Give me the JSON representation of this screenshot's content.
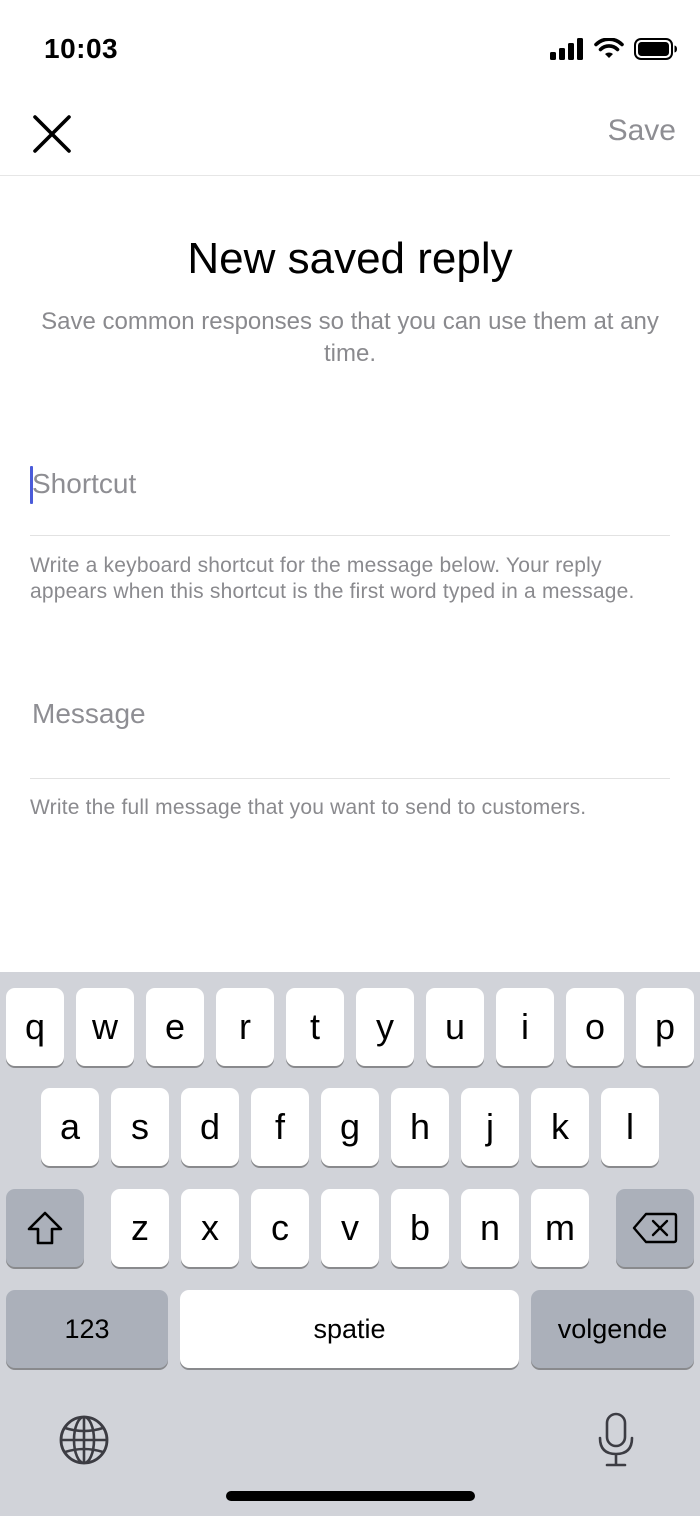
{
  "status_bar": {
    "time": "10:03"
  },
  "nav": {
    "save_label": "Save"
  },
  "header": {
    "title": "New saved reply",
    "subtitle": "Save common responses so that you can use them at any time."
  },
  "form": {
    "shortcut": {
      "placeholder": "Shortcut",
      "value": "",
      "hint": "Write a keyboard shortcut for the message below. Your reply appears when this shortcut is the first word typed in a message."
    },
    "message": {
      "placeholder": "Message",
      "value": "",
      "hint": "Write the full message that you want to send to customers."
    }
  },
  "keyboard": {
    "row1": [
      "q",
      "w",
      "e",
      "r",
      "t",
      "y",
      "u",
      "i",
      "o",
      "p"
    ],
    "row2": [
      "a",
      "s",
      "d",
      "f",
      "g",
      "h",
      "j",
      "k",
      "l"
    ],
    "row3": [
      "z",
      "x",
      "c",
      "v",
      "b",
      "n",
      "m"
    ],
    "numbers_label": "123",
    "space_label": "spatie",
    "return_label": "volgende"
  },
  "icons": {
    "close": "close-icon",
    "shift": "shift-icon",
    "backspace": "backspace-icon",
    "globe": "globe-icon",
    "mic": "microphone-icon",
    "signal": "cellular-signal-icon",
    "wifi": "wifi-icon",
    "battery": "battery-icon"
  },
  "colors": {
    "caret": "#4a5bd9",
    "keyboard_bg": "#d1d3d9",
    "placeholder": "#8e8e93"
  }
}
